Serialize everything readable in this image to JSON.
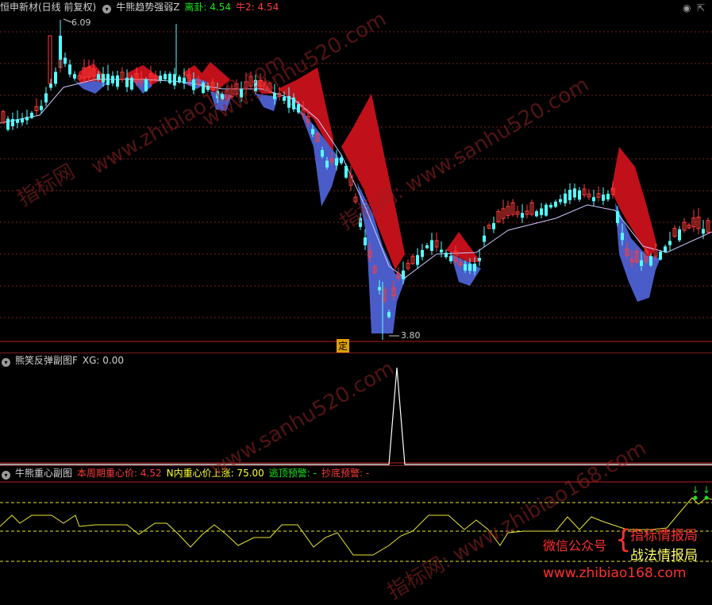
{
  "main": {
    "title": "恒申新材(日线 前复权)",
    "indicator": "牛熊趋势强弱Z",
    "li_gua_label": "离卦: 4.54",
    "niu2_label": "牛2: 4.54",
    "high_label": "6.09",
    "low_label": "3.80",
    "ding_label": "定"
  },
  "sub1": {
    "title": "熊笑反弹副图F",
    "xg_label": "XG: 0.00"
  },
  "sub2": {
    "title": "牛熊重心副图",
    "gravity_label": "本周期重心价: 4.52",
    "n_rise_label": "N内重心价上涨: 75.00",
    "top_warn_label": "逃顶预警: -",
    "bottom_warn_label": "抄底预警: -"
  },
  "watermarks": [
    "www.sanhu520.com",
    "指标网",
    "www.zhibiao168.com",
    "指标网: www.sanhu520.com",
    "www.sanhu520.com",
    "指标网: www.zhibiao168.com"
  ],
  "promo": {
    "wechat": "微信公众号",
    "brace": "{",
    "line1": "指标情报局",
    "line2": "战法情报局",
    "url": "www.zhibiao168.com"
  },
  "colors": {
    "up": "#ff3b3b",
    "down": "#54ffff",
    "red_band": "#c0101a",
    "blue_band": "#4a5cc8",
    "ma": "#c8c8ff",
    "grid": "#7a1f1f",
    "green": "#19e619",
    "yellow": "#ffff33"
  }
}
